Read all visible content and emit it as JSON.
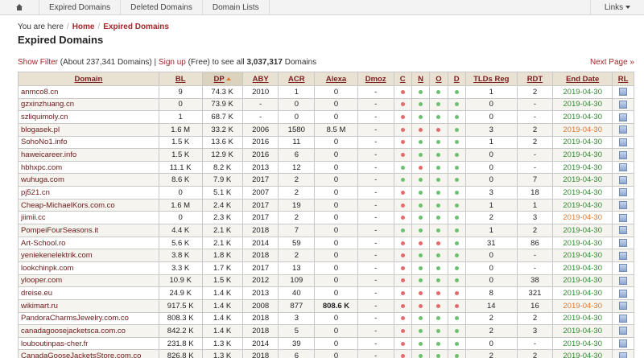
{
  "nav": {
    "items": [
      "Expired Domains",
      "Deleted Domains",
      "Domain Lists"
    ],
    "links_label": "Links"
  },
  "breadcrumb": {
    "prefix": "You are here",
    "home": "Home",
    "current": "Expired Domains"
  },
  "page_title": "Expired Domains",
  "filter": {
    "show_filter": "Show Filter",
    "about_text": "(About 237,341 Domains) |",
    "signup": "Sign up",
    "tail_text": "(Free) to see all",
    "total": "3,037,317",
    "domains_word": "Domains"
  },
  "next_page": "Next Page »",
  "table": {
    "columns": [
      "Domain",
      "BL",
      "DP",
      "ABY",
      "ACR",
      "Alexa",
      "Dmoz",
      "C",
      "N",
      "O",
      "D",
      "TLDs Reg",
      "RDT",
      "End Date",
      "RL"
    ],
    "rows": [
      {
        "domain": "anmco8.cn",
        "bl": "9",
        "dp": "74.3 K",
        "aby": "2010",
        "acr": "1",
        "alexa": "0",
        "dmoz": "-",
        "c": "red",
        "n": "green",
        "o": "green",
        "d": "green",
        "tlds": "1",
        "rdt": "2",
        "end": "2019-04-30",
        "end_color": "green",
        "alexa_bold": false
      },
      {
        "domain": "gzxinzhuang.cn",
        "bl": "0",
        "dp": "73.9 K",
        "aby": "-",
        "acr": "0",
        "alexa": "0",
        "dmoz": "-",
        "c": "red",
        "n": "green",
        "o": "green",
        "d": "green",
        "tlds": "0",
        "rdt": "-",
        "end": "2019-04-30",
        "end_color": "green",
        "alexa_bold": false
      },
      {
        "domain": "szliquimoly.cn",
        "bl": "1",
        "dp": "68.7 K",
        "aby": "-",
        "acr": "0",
        "alexa": "0",
        "dmoz": "-",
        "c": "red",
        "n": "green",
        "o": "green",
        "d": "green",
        "tlds": "0",
        "rdt": "-",
        "end": "2019-04-30",
        "end_color": "green",
        "alexa_bold": false
      },
      {
        "domain": "blogasek.pl",
        "bl": "1.6 M",
        "dp": "33.2 K",
        "aby": "2006",
        "acr": "1580",
        "alexa": "8.5 M",
        "dmoz": "-",
        "c": "red",
        "n": "red",
        "o": "red",
        "d": "green",
        "tlds": "3",
        "rdt": "2",
        "end": "2019-04-30",
        "end_color": "orange",
        "alexa_bold": false
      },
      {
        "domain": "SohoNo1.info",
        "bl": "1.5 K",
        "dp": "13.6 K",
        "aby": "2016",
        "acr": "11",
        "alexa": "0",
        "dmoz": "-",
        "c": "red",
        "n": "green",
        "o": "green",
        "d": "green",
        "tlds": "1",
        "rdt": "2",
        "end": "2019-04-30",
        "end_color": "green",
        "alexa_bold": false
      },
      {
        "domain": "haweicareer.info",
        "bl": "1.5 K",
        "dp": "12.9 K",
        "aby": "2016",
        "acr": "6",
        "alexa": "0",
        "dmoz": "-",
        "c": "red",
        "n": "green",
        "o": "green",
        "d": "green",
        "tlds": "0",
        "rdt": "-",
        "end": "2019-04-30",
        "end_color": "green",
        "alexa_bold": false
      },
      {
        "domain": "hbhxpc.com",
        "bl": "11.1 K",
        "dp": "8.2 K",
        "aby": "2013",
        "acr": "12",
        "alexa": "0",
        "dmoz": "-",
        "c": "green",
        "n": "red",
        "o": "green",
        "d": "green",
        "tlds": "0",
        "rdt": "-",
        "end": "2019-04-30",
        "end_color": "green",
        "alexa_bold": false
      },
      {
        "domain": "wuhuga.com",
        "bl": "8.6 K",
        "dp": "7.9 K",
        "aby": "2017",
        "acr": "2",
        "alexa": "0",
        "dmoz": "-",
        "c": "green",
        "n": "green",
        "o": "green",
        "d": "green",
        "tlds": "0",
        "rdt": "7",
        "end": "2019-04-30",
        "end_color": "green",
        "alexa_bold": false
      },
      {
        "domain": "pj521.cn",
        "bl": "0",
        "dp": "5.1 K",
        "aby": "2007",
        "acr": "2",
        "alexa": "0",
        "dmoz": "-",
        "c": "red",
        "n": "green",
        "o": "green",
        "d": "green",
        "tlds": "3",
        "rdt": "18",
        "end": "2019-04-30",
        "end_color": "green",
        "alexa_bold": false
      },
      {
        "domain": "Cheap-MichaelKors.com.co",
        "bl": "1.6 M",
        "dp": "2.4 K",
        "aby": "2017",
        "acr": "19",
        "alexa": "0",
        "dmoz": "-",
        "c": "red",
        "n": "green",
        "o": "green",
        "d": "green",
        "tlds": "1",
        "rdt": "1",
        "end": "2019-04-30",
        "end_color": "green",
        "alexa_bold": false
      },
      {
        "domain": "jiimii.cc",
        "bl": "0",
        "dp": "2.3 K",
        "aby": "2017",
        "acr": "2",
        "alexa": "0",
        "dmoz": "-",
        "c": "red",
        "n": "green",
        "o": "green",
        "d": "green",
        "tlds": "2",
        "rdt": "3",
        "end": "2019-04-30",
        "end_color": "orange",
        "alexa_bold": false
      },
      {
        "domain": "PompeiFourSeasons.it",
        "bl": "4.4 K",
        "dp": "2.1 K",
        "aby": "2018",
        "acr": "7",
        "alexa": "0",
        "dmoz": "-",
        "c": "green",
        "n": "green",
        "o": "green",
        "d": "green",
        "tlds": "1",
        "rdt": "2",
        "end": "2019-04-30",
        "end_color": "green",
        "alexa_bold": false
      },
      {
        "domain": "Art-School.ro",
        "bl": "5.6 K",
        "dp": "2.1 K",
        "aby": "2014",
        "acr": "59",
        "alexa": "0",
        "dmoz": "-",
        "c": "red",
        "n": "red",
        "o": "red",
        "d": "green",
        "tlds": "31",
        "rdt": "86",
        "end": "2019-04-30",
        "end_color": "green",
        "alexa_bold": false
      },
      {
        "domain": "yeniekenelektrik.com",
        "bl": "3.8 K",
        "dp": "1.8 K",
        "aby": "2018",
        "acr": "2",
        "alexa": "0",
        "dmoz": "-",
        "c": "red",
        "n": "green",
        "o": "green",
        "d": "green",
        "tlds": "0",
        "rdt": "-",
        "end": "2019-04-30",
        "end_color": "green",
        "alexa_bold": false
      },
      {
        "domain": "lookchinpk.com",
        "bl": "3.3 K",
        "dp": "1.7 K",
        "aby": "2017",
        "acr": "13",
        "alexa": "0",
        "dmoz": "-",
        "c": "red",
        "n": "green",
        "o": "green",
        "d": "green",
        "tlds": "0",
        "rdt": "-",
        "end": "2019-04-30",
        "end_color": "green",
        "alexa_bold": false
      },
      {
        "domain": "ylooper.com",
        "bl": "10.9 K",
        "dp": "1.5 K",
        "aby": "2012",
        "acr": "109",
        "alexa": "0",
        "dmoz": "-",
        "c": "red",
        "n": "green",
        "o": "green",
        "d": "green",
        "tlds": "0",
        "rdt": "38",
        "end": "2019-04-30",
        "end_color": "green",
        "alexa_bold": false
      },
      {
        "domain": "dreise.eu",
        "bl": "24.9 K",
        "dp": "1.4 K",
        "aby": "2013",
        "acr": "40",
        "alexa": "0",
        "dmoz": "-",
        "c": "red",
        "n": "red",
        "o": "red",
        "d": "red",
        "tlds": "8",
        "rdt": "321",
        "end": "2019-04-30",
        "end_color": "green",
        "alexa_bold": false
      },
      {
        "domain": "wikimart.ru",
        "bl": "917.5 K",
        "dp": "1.4 K",
        "aby": "2008",
        "acr": "877",
        "alexa": "808.6 K",
        "dmoz": "-",
        "c": "red",
        "n": "red",
        "o": "red",
        "d": "red",
        "tlds": "14",
        "rdt": "16",
        "end": "2019-04-30",
        "end_color": "orange",
        "alexa_bold": true
      },
      {
        "domain": "PandoraCharmsJewelry.com.co",
        "bl": "808.3 K",
        "dp": "1.4 K",
        "aby": "2018",
        "acr": "3",
        "alexa": "0",
        "dmoz": "-",
        "c": "red",
        "n": "green",
        "o": "green",
        "d": "green",
        "tlds": "2",
        "rdt": "2",
        "end": "2019-04-30",
        "end_color": "green",
        "alexa_bold": false
      },
      {
        "domain": "canadagoosejacketsca.com.co",
        "bl": "842.2 K",
        "dp": "1.4 K",
        "aby": "2018",
        "acr": "5",
        "alexa": "0",
        "dmoz": "-",
        "c": "red",
        "n": "green",
        "o": "green",
        "d": "green",
        "tlds": "2",
        "rdt": "3",
        "end": "2019-04-30",
        "end_color": "green",
        "alexa_bold": false
      },
      {
        "domain": "louboutinpas-cher.fr",
        "bl": "231.8 K",
        "dp": "1.3 K",
        "aby": "2014",
        "acr": "39",
        "alexa": "0",
        "dmoz": "-",
        "c": "red",
        "n": "green",
        "o": "green",
        "d": "green",
        "tlds": "0",
        "rdt": "-",
        "end": "2019-04-30",
        "end_color": "green",
        "alexa_bold": false
      },
      {
        "domain": "CanadaGooseJacketsStore.com.co",
        "bl": "826.8 K",
        "dp": "1.3 K",
        "aby": "2018",
        "acr": "6",
        "alexa": "0",
        "dmoz": "-",
        "c": "red",
        "n": "green",
        "o": "green",
        "d": "green",
        "tlds": "2",
        "rdt": "2",
        "end": "2019-04-30",
        "end_color": "green",
        "alexa_bold": false
      }
    ]
  }
}
